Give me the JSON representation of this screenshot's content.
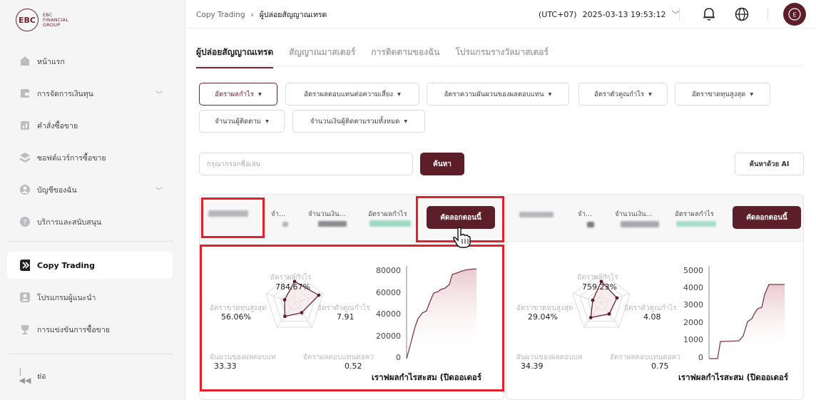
{
  "brand": {
    "logo_initials": "EBC",
    "logo_text": [
      "EBC",
      "FINANCIAL",
      "GROUP"
    ]
  },
  "sidebar": {
    "items": [
      {
        "label": "หน้าแรก",
        "icon": "home-icon"
      },
      {
        "label": "การจัดการเงินทุน",
        "icon": "wallet-icon",
        "expandable": true
      },
      {
        "label": "คำสั่งซื้อขาย",
        "icon": "orders-icon"
      },
      {
        "label": "ซอฟต์แวร์การซื้อขาย",
        "icon": "software-icon"
      },
      {
        "label": "บัญชีของฉัน",
        "icon": "account-icon",
        "expandable": true
      },
      {
        "label": "บริการและสนับสนุน",
        "icon": "help-icon"
      },
      {
        "label": "Copy Trading",
        "icon": "copy-trading-icon",
        "active": true
      },
      {
        "label": "โปรแกรมผู้แนะนำ",
        "icon": "referral-icon"
      },
      {
        "label": "การแข่งขันการซื้อขาย",
        "icon": "trophy-icon"
      }
    ],
    "collapse_label": "ย่อ"
  },
  "topbar": {
    "breadcrumb": [
      "Copy Trading",
      "ผู้ปล่อยสัญญาณเทรด"
    ],
    "timezone": "(UTC+07)",
    "datetime": "2025-03-13 19:53:12"
  },
  "tabs": [
    "ผู้ปล่อยสัญญาณเทรด",
    "สัญญาณมาสเตอร์",
    "การติดตามของฉัน",
    "โปรแกรมรางวัลมาสเตอร์"
  ],
  "filters": [
    "อัตราผลกำไร",
    "อัตราผลตอบแทนต่อความเสี่ยง",
    "อัตราความผันผวนของผลตอบแทน",
    "อัตราตัวคูณกำไร",
    "อัตราขาดทุนสูงสุด",
    "จำนวนผู้ติดตาม",
    "จำนวนเงินผู้ติดตามรวมทั้งหมด"
  ],
  "search": {
    "placeholder": "กรุณากรอกชื่อเล่น",
    "button": "ค้นหา",
    "ai_button": "ค้นหาด้วย AI"
  },
  "cards": [
    {
      "col_labels": [
        "จำ...",
        "จำนวนเงิน...",
        "อัตราผลกำไร"
      ],
      "copy_button": "คัดลอกตอนนี้",
      "radar": {
        "labels": [
          "อัตราผลกำไร",
          "อัตราตัวคูณกำไร",
          "อัตราผลตอบแทนต่อความเสี่ยง",
          "อัตราความผันผวนของผลตอบแทน",
          "อัตราขาดทุนสูงสุด"
        ],
        "label_shown": [
          "อัตราผลกำไร",
          "อัตราตัวคูณกำไร",
          "อัตราผลตอบแทนต่อคว",
          "ผันผวนของผลตอบแทน",
          "อัตราขาดทุนสูงสุด"
        ],
        "values": [
          "784.67%",
          "7.91",
          "0.52",
          "33.33",
          "56.06%"
        ],
        "norm": [
          0.72,
          0.85,
          0.4,
          0.55,
          0.35
        ]
      },
      "chart": {
        "title": "เราฟผลกำไรสะสม (ปิดออเดอร์",
        "yticks": [
          "80000",
          "60000",
          "40000",
          "20000",
          "0"
        ]
      }
    },
    {
      "col_labels": [
        "จำ...",
        "จำนวนเงิน...",
        "อัตราผลกำไร"
      ],
      "copy_button": "คัดลอกตอนนี้",
      "radar": {
        "labels": [
          "อัตราผลกำไร",
          "อัตราตัวคูณกำไร",
          "อัตราผลตอบแทนต่อความเสี่ยง",
          "อัตราความผันผวนของผลตอบแทน",
          "อัตราขาดทุนสูงสุด"
        ],
        "label_shown": [
          "อัตราผลกำไร",
          "อัตราตัวคูณกำไร",
          "อัตราผลตอบแทนต่อคว",
          "ผันผวนของผลตอบแทน",
          "อัตราขาดทุนสูงสุด"
        ],
        "values": [
          "759.23%",
          "4.08",
          "0.75",
          "34.39",
          "29.04%"
        ],
        "norm": [
          0.72,
          0.55,
          0.45,
          0.6,
          0.3
        ]
      },
      "chart": {
        "title": "เราฟผลกำไรสะสม (ปิดออเดอร์",
        "yticks": [
          "5000",
          "4000",
          "3000",
          "2000",
          "1000",
          "0"
        ]
      }
    }
  ],
  "colors": {
    "accent": "#5c1f2a",
    "highlight": "#e0202a"
  }
}
